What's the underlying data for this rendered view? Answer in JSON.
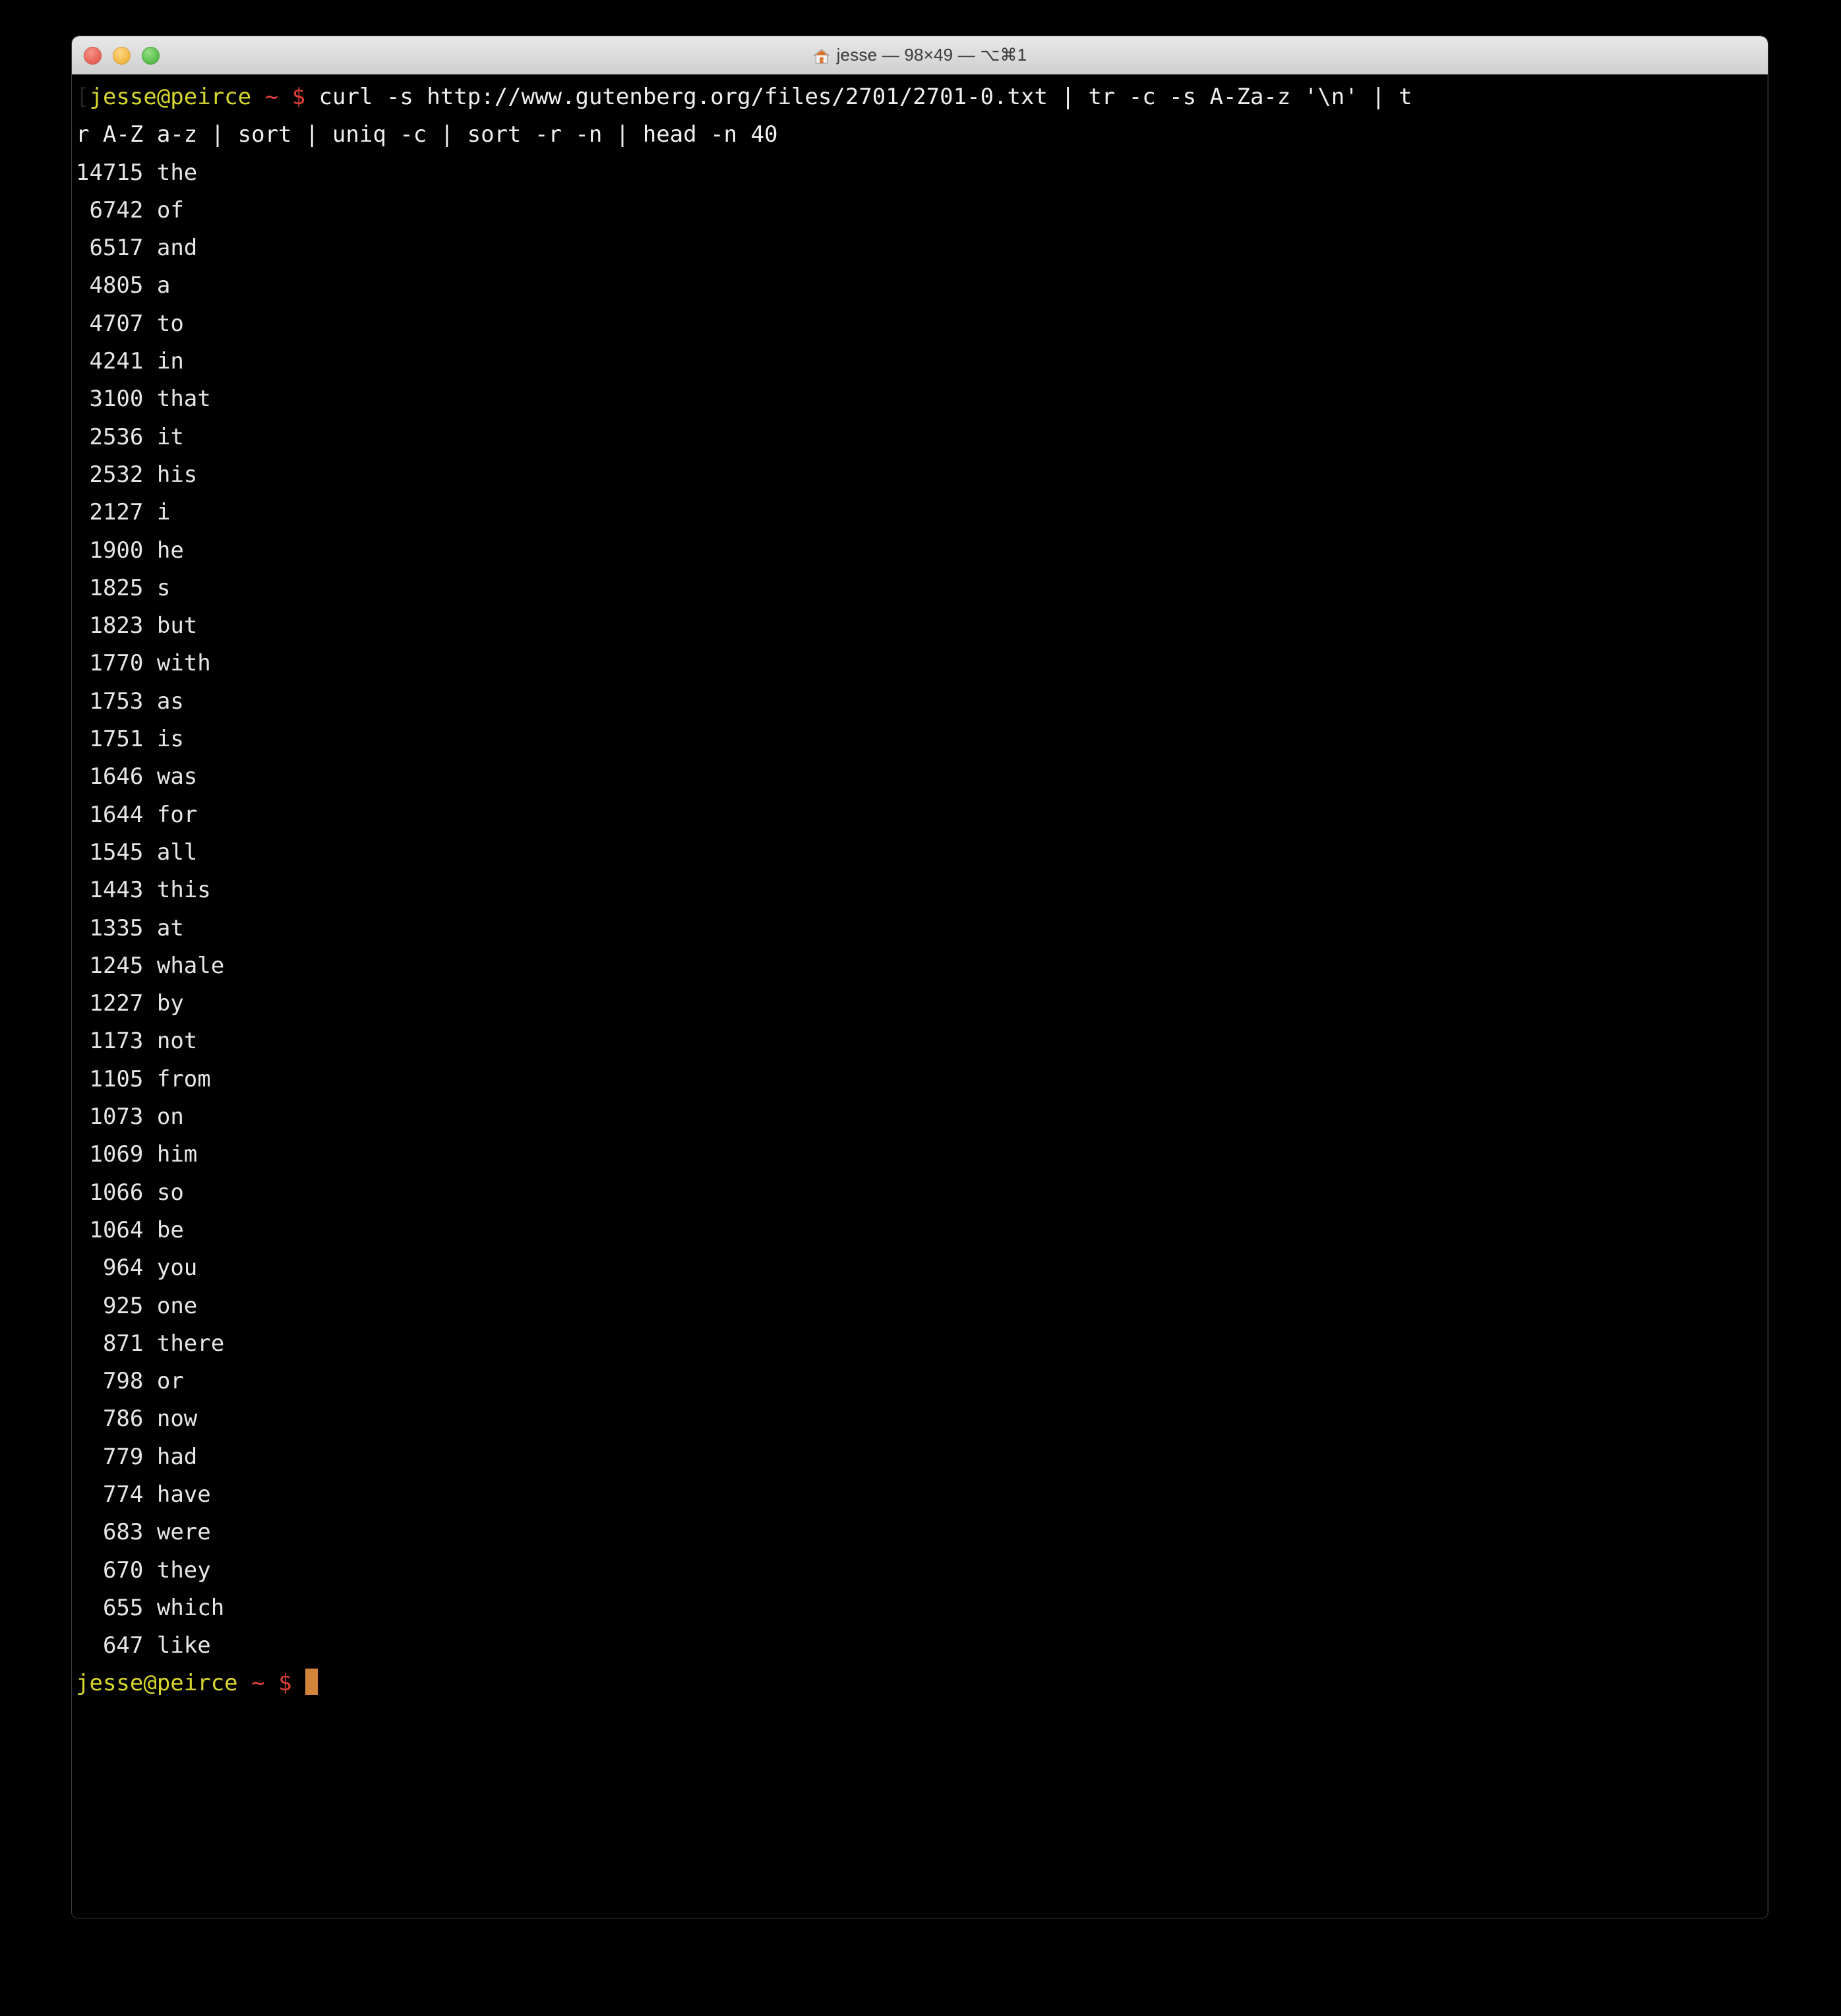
{
  "window": {
    "title": "jesse — 98×49 — ⌥⌘1",
    "title_icon": "home-icon",
    "controls": {
      "close_label": "",
      "minimize_label": "",
      "zoom_label": ""
    },
    "colors": {
      "background": "#000000",
      "foreground": "#e6e6e6",
      "titlebar": "#dedede",
      "close": "#ec6a5e",
      "minimize": "#f5bd4f",
      "zoom": "#62c455",
      "prompt_user": "#d7d62f",
      "prompt_cwd": "#e1413a",
      "prompt_sigil": "#e1413a",
      "cursor": "#d2853a"
    },
    "size": "98×49"
  },
  "prompt": {
    "user_host": "jesse@peirce",
    "cwd": "~",
    "sigil": "$",
    "leading_bracket": "["
  },
  "command": {
    "line1": "curl -s http://www.gutenberg.org/files/2701/2701-0.txt | tr -c -s A-Za-z '\\n' | t",
    "line2": "r A-Z a-z | sort | uniq -c | sort -r -n | head -n 40",
    "full": "curl -s http://www.gutenberg.org/files/2701/2701-0.txt | tr -c -s A-Za-z '\\n' | tr A-Z a-z | sort | uniq -c | sort -r -n | head -n 40"
  },
  "output": {
    "rows": [
      {
        "count": "14715",
        "word": "the"
      },
      {
        "count": "6742",
        "word": "of"
      },
      {
        "count": "6517",
        "word": "and"
      },
      {
        "count": "4805",
        "word": "a"
      },
      {
        "count": "4707",
        "word": "to"
      },
      {
        "count": "4241",
        "word": "in"
      },
      {
        "count": "3100",
        "word": "that"
      },
      {
        "count": "2536",
        "word": "it"
      },
      {
        "count": "2532",
        "word": "his"
      },
      {
        "count": "2127",
        "word": "i"
      },
      {
        "count": "1900",
        "word": "he"
      },
      {
        "count": "1825",
        "word": "s"
      },
      {
        "count": "1823",
        "word": "but"
      },
      {
        "count": "1770",
        "word": "with"
      },
      {
        "count": "1753",
        "word": "as"
      },
      {
        "count": "1751",
        "word": "is"
      },
      {
        "count": "1646",
        "word": "was"
      },
      {
        "count": "1644",
        "word": "for"
      },
      {
        "count": "1545",
        "word": "all"
      },
      {
        "count": "1443",
        "word": "this"
      },
      {
        "count": "1335",
        "word": "at"
      },
      {
        "count": "1245",
        "word": "whale"
      },
      {
        "count": "1227",
        "word": "by"
      },
      {
        "count": "1173",
        "word": "not"
      },
      {
        "count": "1105",
        "word": "from"
      },
      {
        "count": "1073",
        "word": "on"
      },
      {
        "count": "1069",
        "word": "him"
      },
      {
        "count": "1066",
        "word": "so"
      },
      {
        "count": "1064",
        "word": "be"
      },
      {
        "count": "964",
        "word": "you"
      },
      {
        "count": "925",
        "word": "one"
      },
      {
        "count": "871",
        "word": "there"
      },
      {
        "count": "798",
        "word": "or"
      },
      {
        "count": "786",
        "word": "now"
      },
      {
        "count": "779",
        "word": "had"
      },
      {
        "count": "774",
        "word": "have"
      },
      {
        "count": "683",
        "word": "were"
      },
      {
        "count": "670",
        "word": "they"
      },
      {
        "count": "655",
        "word": "which"
      },
      {
        "count": "647",
        "word": "like"
      }
    ]
  }
}
